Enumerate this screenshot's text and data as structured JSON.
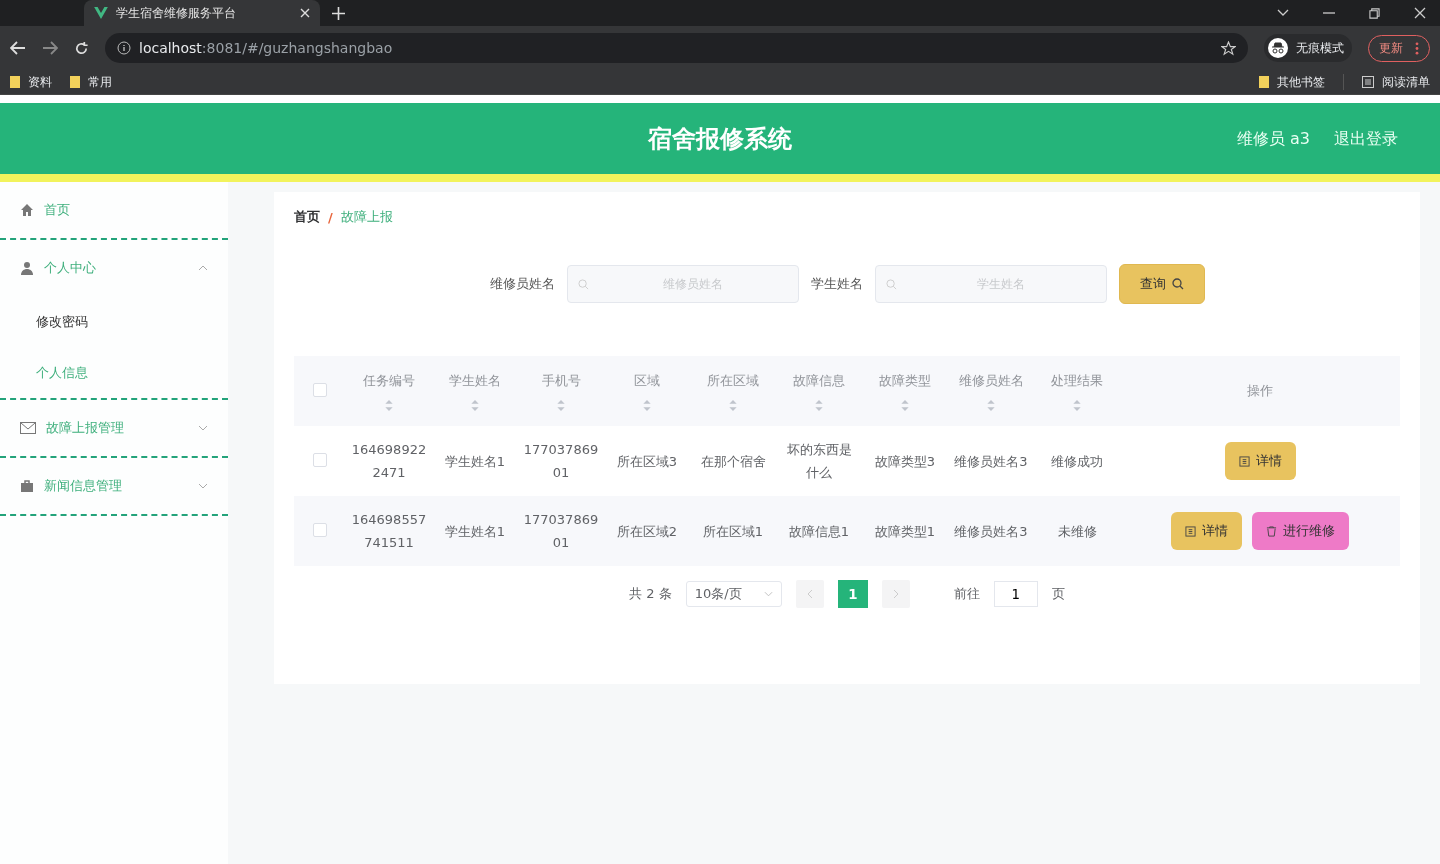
{
  "browser": {
    "tabs": [
      {
        "title": "学生宿舍维修服务平台",
        "selected": true
      }
    ],
    "url_host": "localhost",
    "url_rest": ":8081/#/guzhangshangbao",
    "profile": "无痕模式",
    "update": "更新",
    "bookmarks": [
      "资料",
      "常用"
    ],
    "other_bookmarks": "其他书签",
    "reading_list": "阅读清单"
  },
  "header": {
    "title": "宿舍报修系统",
    "user": "维修员 a3",
    "logout": "退出登录"
  },
  "sidebar": {
    "items": [
      {
        "label": "首页"
      },
      {
        "label": "个人中心",
        "expanded": true,
        "children": [
          {
            "label": "修改密码",
            "selected": false
          },
          {
            "label": "个人信息",
            "selected": true
          }
        ]
      },
      {
        "label": "故障上报管理",
        "expanded": false
      },
      {
        "label": "新闻信息管理",
        "expanded": false
      }
    ]
  },
  "breadcrumb": [
    "首页",
    "故障上报"
  ],
  "breadcrumb_separator": "/",
  "search": {
    "fields": [
      {
        "label": "维修员姓名",
        "placeholder": "维修员姓名"
      },
      {
        "label": "学生姓名",
        "placeholder": "学生姓名"
      }
    ],
    "button": "查询"
  },
  "table": {
    "all_checked": false,
    "columns": [
      {
        "label": "任务编号",
        "sortable": true
      },
      {
        "label": "学生姓名",
        "sortable": true
      },
      {
        "label": "手机号",
        "sortable": true
      },
      {
        "label": "区域",
        "sortable": true
      },
      {
        "label": "所在区域",
        "sortable": true
      },
      {
        "label": "故障信息",
        "sortable": true
      },
      {
        "label": "故障类型",
        "sortable": true
      },
      {
        "label": "维修员姓名",
        "sortable": true
      },
      {
        "label": "处理结果",
        "sortable": true
      },
      {
        "label": "操作",
        "sortable": false
      }
    ],
    "rows": [
      {
        "checked": false,
        "cells": [
          "1646989222471",
          "学生姓名1",
          "17703786901",
          "所在区域3",
          "在那个宿舍",
          "坏的东西是什么",
          "故障类型3",
          "维修员姓名3",
          "维修成功"
        ],
        "actions": [
          {
            "label": "详情",
            "kind": "detail"
          }
        ]
      },
      {
        "checked": false,
        "cells": [
          "164698557741511",
          "学生姓名1",
          "17703786901",
          "所在区域2",
          "所在区域1",
          "故障信息1",
          "故障类型1",
          "维修员姓名3",
          "未维修"
        ],
        "actions": [
          {
            "label": "详情",
            "kind": "detail"
          },
          {
            "label": "进行维修",
            "kind": "repair"
          }
        ]
      }
    ]
  },
  "pagination": {
    "total": "共 2 条",
    "page_size": "10条/页",
    "pages": [
      {
        "label": "1",
        "selected": true
      }
    ],
    "goto": "前往",
    "goto_value": "1",
    "suffix": "页"
  }
}
